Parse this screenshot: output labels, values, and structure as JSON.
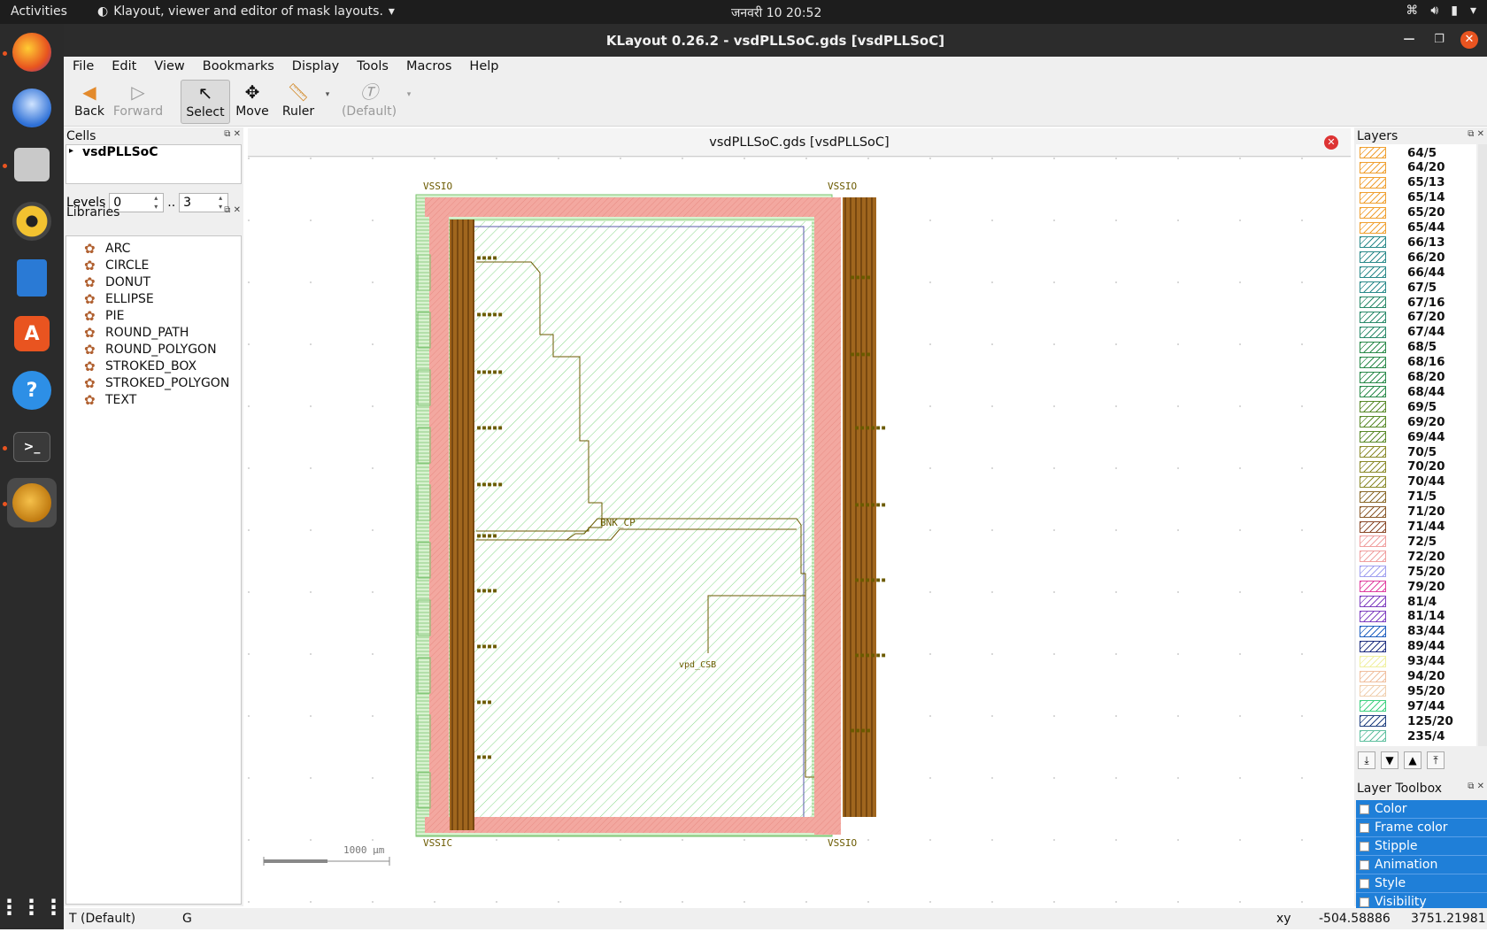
{
  "topbar": {
    "activities": "Activities",
    "app_name": "Klayout, viewer and editor of mask layouts.",
    "clock": "जनवरी 10  20:52"
  },
  "window": {
    "title": "KLayout 0.26.2 - vsdPLLSoC.gds [vsdPLLSoC]"
  },
  "menubar": [
    "File",
    "Edit",
    "View",
    "Bookmarks",
    "Display",
    "Tools",
    "Macros",
    "Help"
  ],
  "toolbar": {
    "back": "Back",
    "forward": "Forward",
    "select": "Select",
    "move": "Move",
    "ruler": "Ruler",
    "default": "(Default)"
  },
  "cells": {
    "title": "Cells",
    "top_cell": "vsdPLLSoC",
    "levels_label": "Levels",
    "level_from": "0",
    "level_sep": "..",
    "level_to": "3"
  },
  "libraries": {
    "title": "Libraries",
    "items": [
      "ARC",
      "CIRCLE",
      "DONUT",
      "ELLIPSE",
      "PIE",
      "ROUND_PATH",
      "ROUND_POLYGON",
      "STROKED_BOX",
      "STROKED_POLYGON",
      "TEXT"
    ]
  },
  "canvas": {
    "tab_title": "vsdPLLSoC.gds [vsdPLLSoC]",
    "scale_label": "1000 µm",
    "labels": {
      "vssio_tl": "VSSIO",
      "vssio_tr": "VSSIO",
      "vssio_bl": "VSSIC",
      "vssio_br": "VSSIO",
      "cp": "BNK_CP",
      "vdd": "vpd_CSB"
    }
  },
  "layers": {
    "title": "Layers",
    "items": [
      {
        "label": "64/5",
        "color": "#f0a030"
      },
      {
        "label": "64/20",
        "color": "#f0a030"
      },
      {
        "label": "65/13",
        "color": "#f0a030"
      },
      {
        "label": "65/14",
        "color": "#f0a030"
      },
      {
        "label": "65/20",
        "color": "#f0a030"
      },
      {
        "label": "65/44",
        "color": "#f0a030"
      },
      {
        "label": "66/13",
        "color": "#2a8a8a"
      },
      {
        "label": "66/20",
        "color": "#2a8a8a"
      },
      {
        "label": "66/44",
        "color": "#2a8a8a"
      },
      {
        "label": "67/5",
        "color": "#2a8a8a"
      },
      {
        "label": "67/16",
        "color": "#2a8a6a"
      },
      {
        "label": "67/20",
        "color": "#2a8a6a"
      },
      {
        "label": "67/44",
        "color": "#2a8a6a"
      },
      {
        "label": "68/5",
        "color": "#2a8a4a"
      },
      {
        "label": "68/16",
        "color": "#2a8a4a"
      },
      {
        "label": "68/20",
        "color": "#2a8a4a"
      },
      {
        "label": "68/44",
        "color": "#2a8a4a"
      },
      {
        "label": "69/5",
        "color": "#5a8a2a"
      },
      {
        "label": "69/20",
        "color": "#5a8a2a"
      },
      {
        "label": "69/44",
        "color": "#5a8a2a"
      },
      {
        "label": "70/5",
        "color": "#8a8a2a"
      },
      {
        "label": "70/20",
        "color": "#8a8a2a"
      },
      {
        "label": "70/44",
        "color": "#8a8a2a"
      },
      {
        "label": "71/5",
        "color": "#8a6a2a"
      },
      {
        "label": "71/20",
        "color": "#8a5a2a"
      },
      {
        "label": "71/44",
        "color": "#8a4a2a"
      },
      {
        "label": "72/5",
        "color": "#f0a0a0"
      },
      {
        "label": "72/20",
        "color": "#f0a0a0"
      },
      {
        "label": "75/20",
        "color": "#a0a0f0"
      },
      {
        "label": "79/20",
        "color": "#e040a0"
      },
      {
        "label": "81/4",
        "color": "#8040c0"
      },
      {
        "label": "81/14",
        "color": "#8040c0"
      },
      {
        "label": "83/44",
        "color": "#2060c0"
      },
      {
        "label": "89/44",
        "color": "#203080"
      },
      {
        "label": "93/44",
        "color": "#f0f0a0"
      },
      {
        "label": "94/20",
        "color": "#f0c0a0"
      },
      {
        "label": "95/20",
        "color": "#f0d0b0"
      },
      {
        "label": "97/44",
        "color": "#40d080"
      },
      {
        "label": "125/20",
        "color": "#204080"
      },
      {
        "label": "235/4",
        "color": "#60c0a0"
      }
    ]
  },
  "layer_toolbox": {
    "title": "Layer Toolbox",
    "items": [
      "Color",
      "Frame color",
      "Stipple",
      "Animation",
      "Style",
      "Visibility"
    ]
  },
  "status": {
    "mode": "T  (Default)",
    "grid": "G",
    "xy_label": "xy",
    "x": "-504.58886",
    "y": "3751.21981"
  }
}
